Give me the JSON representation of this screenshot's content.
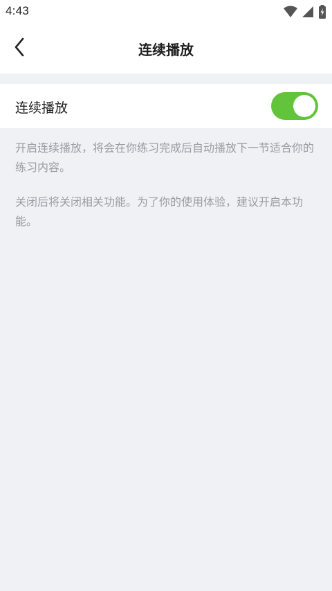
{
  "status_bar": {
    "time": "4:43",
    "icons": [
      "wifi-icon",
      "cellular-signal-icon",
      "battery-charging-icon"
    ]
  },
  "header": {
    "back_icon": "chevron-left-icon",
    "title": "连续播放"
  },
  "setting": {
    "label": "连续播放",
    "enabled": true,
    "accent_color": "#62c43a"
  },
  "description": {
    "paragraph_1": "开启连续播放，将会在你练习完成后自动播放下一节适合你的练习内容。",
    "paragraph_2": "关闭后将关闭相关功能。为了你的使用体验，建议开启本功能。"
  }
}
